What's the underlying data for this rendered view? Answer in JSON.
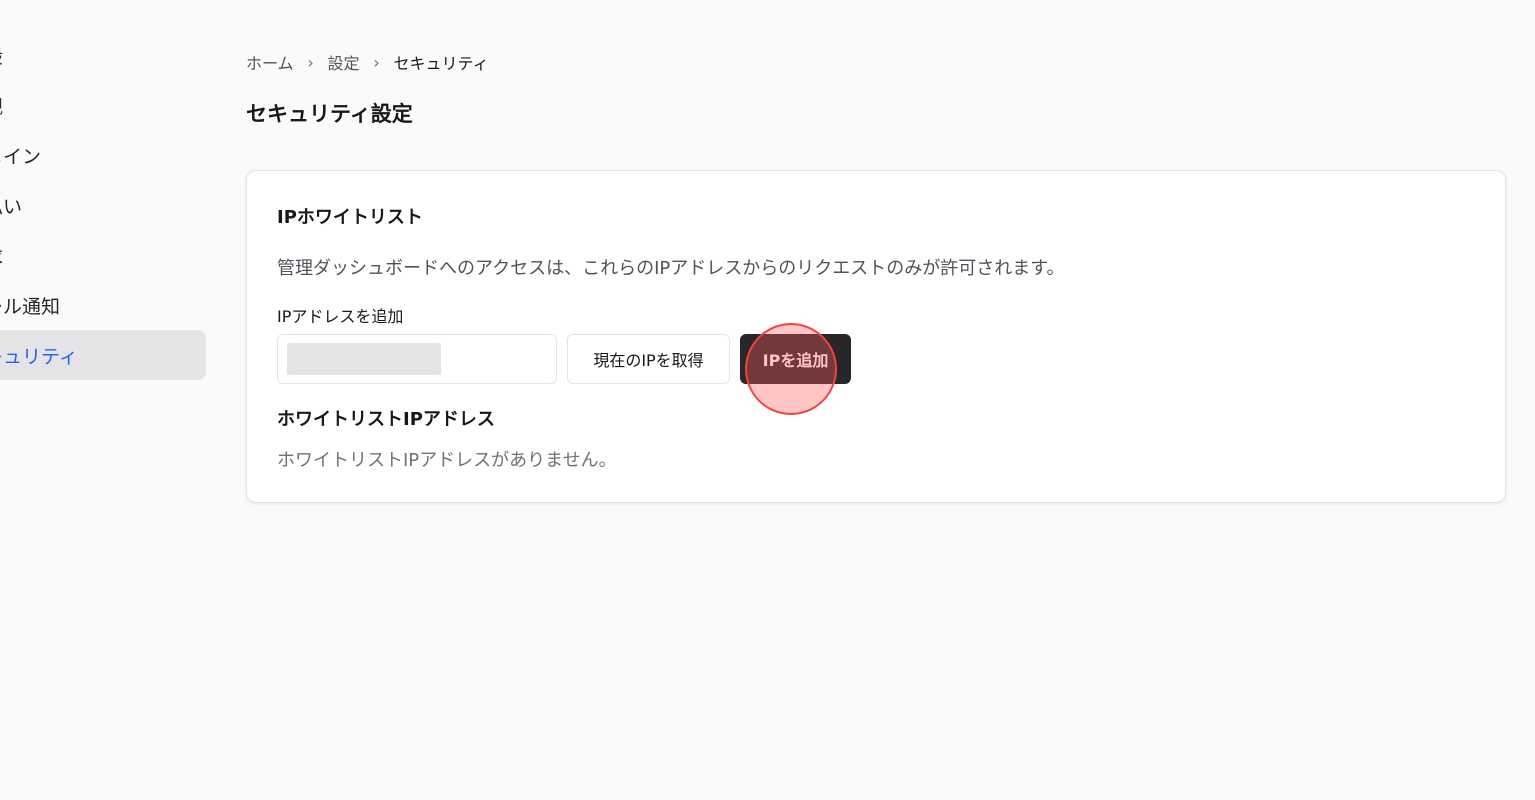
{
  "sidebar": {
    "items": [
      {
        "label": "般",
        "active": false
      },
      {
        "label": "観",
        "active": false
      },
      {
        "label": "メイン",
        "active": false
      },
      {
        "label": "払い",
        "active": false
      },
      {
        "label": "求",
        "active": false
      },
      {
        "label": "ール通知",
        "active": false
      },
      {
        "label": "キュリティ",
        "active": true
      }
    ]
  },
  "breadcrumb": {
    "home": "ホーム",
    "settings": "設定",
    "current": "セキュリティ",
    "separator": "›"
  },
  "page": {
    "title": "セキュリティ設定"
  },
  "card": {
    "title": "IPホワイトリスト",
    "description": "管理ダッシュボードへのアクセスは、これらのIPアドレスからのリクエストのみが許可されます。",
    "add_label": "IPアドレスを追加",
    "input_value": "",
    "get_current_ip_label": "現在のIPを取得",
    "add_ip_label": "IPを追加",
    "list_heading": "ホワイトリストIPアドレス",
    "empty_message": "ホワイトリストIPアドレスがありません。"
  },
  "colors": {
    "accent": "#2563eb",
    "primary_button": "#27272a",
    "click_marker": "#ef4444",
    "background": "#fafafa"
  }
}
